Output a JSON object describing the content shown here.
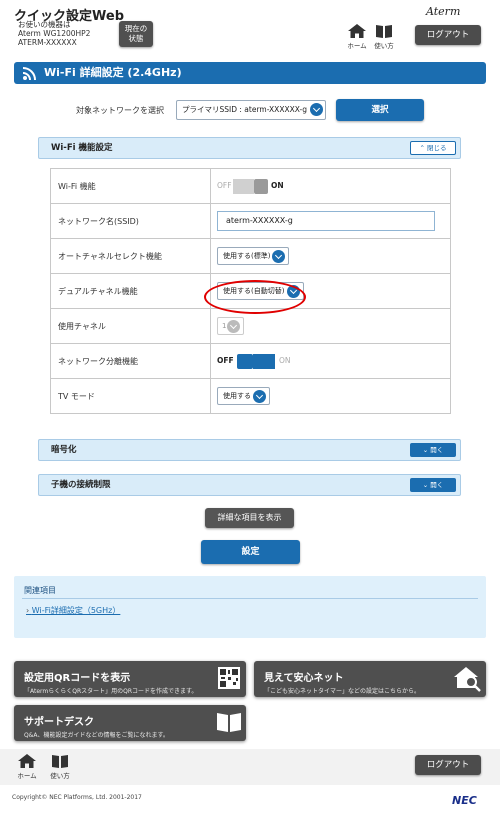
{
  "header": {
    "title": "クイック設定Web",
    "device_caption": "お使いの機器は",
    "device_model": "Aterm WG1200HP2",
    "device_name": "ATERM-XXXXXX",
    "status_button_line1": "現在の",
    "status_button_line2": "状態",
    "brand": "Aterm",
    "home_label": "ホーム",
    "help_label": "使い方",
    "logout_label": "ログアウト"
  },
  "page_title": "Wi-Fi 詳細設定 (2.4GHz)",
  "network_select": {
    "label": "対象ネットワークを選択",
    "value": "プライマリSSID : aterm-XXXXXX-g",
    "button": "選択"
  },
  "wifi_section": {
    "title": "Wi-Fi 機能設定",
    "toggle_label": "閉じる",
    "rows": {
      "wifi_function": {
        "label": "Wi-Fi 機能",
        "off": "OFF",
        "on": "ON"
      },
      "ssid": {
        "label": "ネットワーク名(SSID)",
        "value": "aterm-XXXXXX-g"
      },
      "auto_channel": {
        "label": "オートチャネルセレクト機能",
        "value": "使用する(標準)"
      },
      "dual_channel": {
        "label": "デュアルチャネル機能",
        "value": "使用する(自動切替)"
      },
      "channel": {
        "label": "使用チャネル",
        "value": "1"
      },
      "isolation": {
        "label": "ネットワーク分離機能",
        "off": "OFF",
        "on": "ON"
      },
      "tv_mode": {
        "label": "TV モード",
        "value": "使用する"
      }
    }
  },
  "encryption_section": {
    "title": "暗号化",
    "toggle_label": "開く"
  },
  "client_section": {
    "title": "子機の接続制限",
    "toggle_label": "開く"
  },
  "show_details_button": "詳細な項目を表示",
  "save_button": "設定",
  "related": {
    "heading": "関連項目",
    "link": "Wi-Fi詳細設定（5GHz）"
  },
  "cards": {
    "qr": {
      "title": "設定用QRコードを表示",
      "desc": "「AtermらくらくQRスタート」用のQRコードを作成できます。"
    },
    "safe": {
      "title": "見えて安心ネット",
      "desc": "「こども安心ネットタイマー」などの設定はこちらから。"
    },
    "support": {
      "title": "サポートデスク",
      "desc": "Q&A、機能設定ガイドなどの情報をご覧になれます。"
    }
  },
  "footer": {
    "home_label": "ホーム",
    "help_label": "使い方",
    "logout_label": "ログアウト",
    "copyright": "Copyright© NEC Platforms, Ltd. 2001-2017",
    "brand": "NEC"
  },
  "colors": {
    "accent": "#1b6db0",
    "dark_button": "#4f4f4f",
    "section_bg": "#d9ecf9",
    "highlight": "#e00000"
  }
}
